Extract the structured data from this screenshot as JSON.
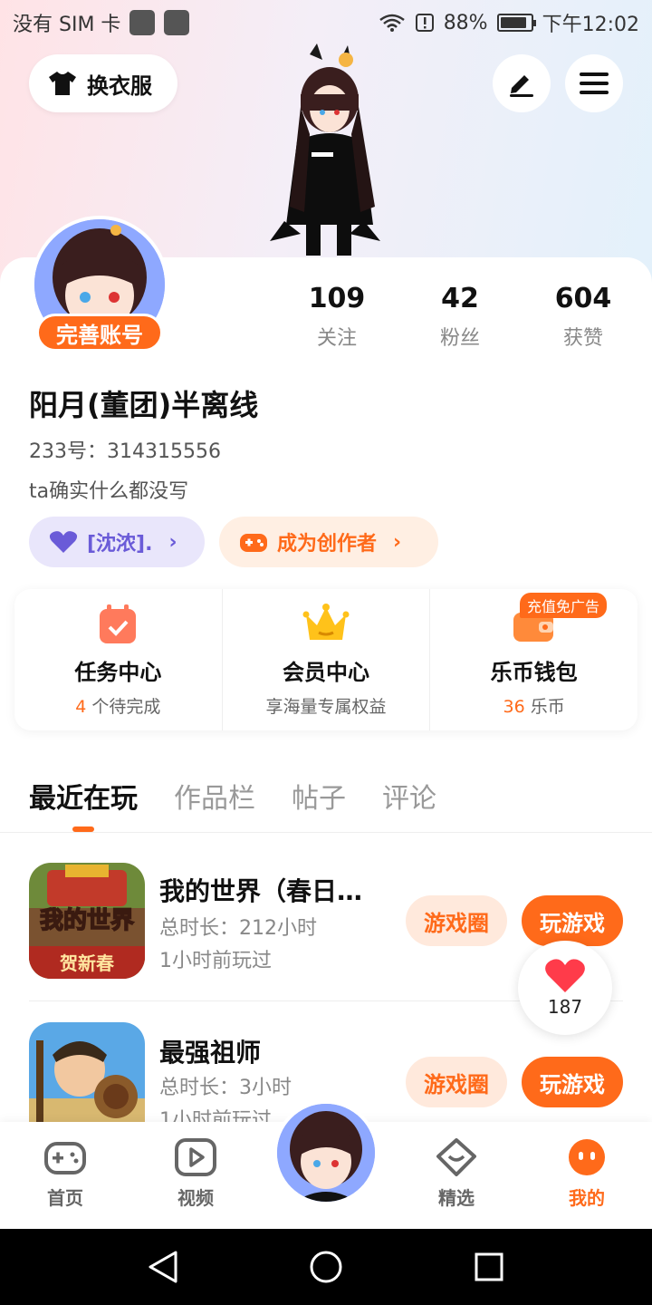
{
  "status_bar": {
    "carrier": "没有 SIM 卡",
    "battery": "88%",
    "time": "下午12:02"
  },
  "header": {
    "dress_label": "换衣服"
  },
  "profile": {
    "complete_badge": "完善账号",
    "stats": [
      {
        "value": "109",
        "label": "关注"
      },
      {
        "value": "42",
        "label": "粉丝"
      },
      {
        "value": "604",
        "label": "获赞"
      }
    ],
    "username": "阳月(董团)半离线",
    "uid": "233号：314315556",
    "bio": "ta确实什么都没写",
    "pill_guild": "[沈浓].",
    "pill_creator": "成为创作者"
  },
  "services": [
    {
      "title": "任务中心",
      "count": "4",
      "sub": "个待完成"
    },
    {
      "title": "会员中心",
      "sub": "享海量专属权益"
    },
    {
      "title": "乐币钱包",
      "count": "36",
      "sub": "乐币",
      "badge": "充值免广告"
    }
  ],
  "tabs": [
    "最近在玩",
    "作品栏",
    "帖子",
    "评论"
  ],
  "games": [
    {
      "title": "我的世界（春日开...",
      "duration": "总时长：212小时",
      "last_played": "1小时前玩过",
      "circle_label": "游戏圈",
      "play_label": "玩游戏",
      "icon_text_top": "我的世界",
      "icon_text_bottom": "贺新春"
    },
    {
      "title": "最强祖师",
      "duration": "总时长：3小时",
      "last_played": "1小时前玩过",
      "circle_label": "游戏圈",
      "play_label": "玩游戏"
    }
  ],
  "like_bubble": {
    "count": "187"
  },
  "bottom_nav": [
    {
      "label": "首页",
      "icon": "gamepad-icon"
    },
    {
      "label": "视频",
      "icon": "video-icon"
    },
    {
      "label": "精选",
      "icon": "heart-box-icon"
    },
    {
      "label": "我的",
      "icon": "profile-face-icon"
    }
  ],
  "colors": {
    "accent": "#ff6a1a",
    "purple": "#6a5bd8"
  }
}
